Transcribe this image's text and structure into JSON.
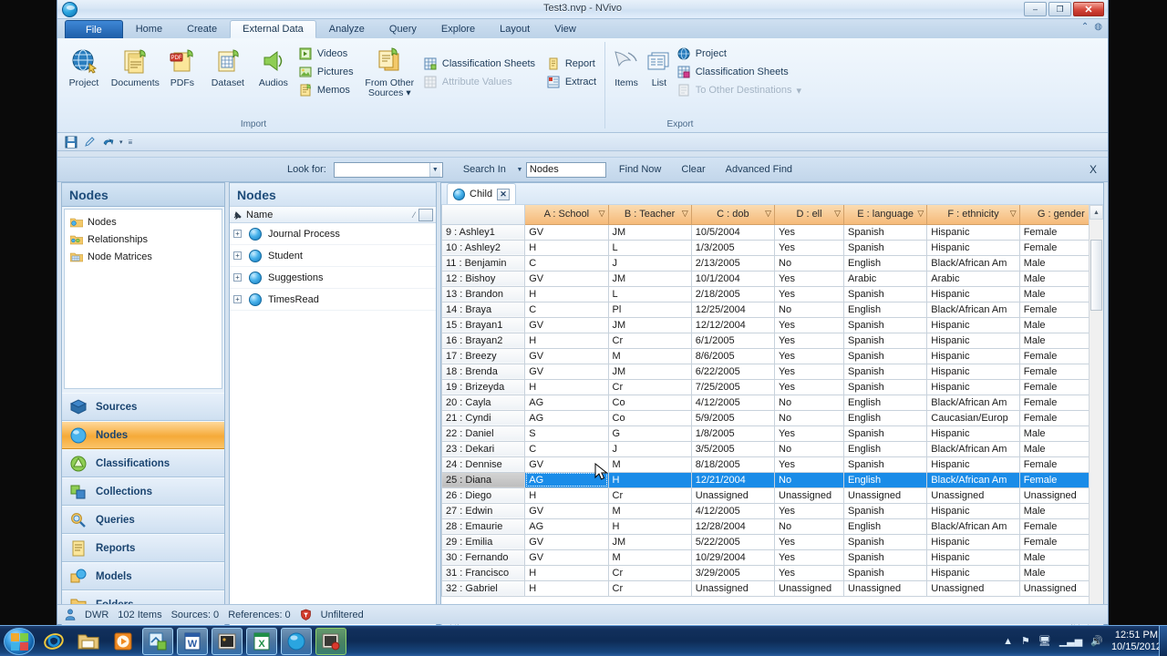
{
  "window": {
    "title": "Test3.nvp - NVivo",
    "minimize": "–",
    "maximize": "❐",
    "close": "✕"
  },
  "ribbon": {
    "tabs": [
      {
        "label": "File",
        "kind": "file"
      },
      {
        "label": "Home",
        "kind": "normal"
      },
      {
        "label": "Create",
        "kind": "normal"
      },
      {
        "label": "External Data",
        "kind": "active"
      },
      {
        "label": "Analyze",
        "kind": "normal"
      },
      {
        "label": "Query",
        "kind": "normal"
      },
      {
        "label": "Explore",
        "kind": "normal"
      },
      {
        "label": "Layout",
        "kind": "normal"
      },
      {
        "label": "View",
        "kind": "normal"
      }
    ],
    "help_icons": [
      "minimize-ribbon-icon",
      "help-icon"
    ],
    "groups": [
      {
        "label": "Import",
        "big_buttons": [
          {
            "label": "Project",
            "icon": "project-globe-icon"
          },
          {
            "label": "Documents",
            "icon": "documents-icon"
          },
          {
            "label": "PDFs",
            "icon": "pdfs-icon"
          },
          {
            "label": "Dataset",
            "icon": "dataset-icon"
          },
          {
            "label": "Audios",
            "icon": "audios-icon"
          }
        ],
        "small_buttons": [
          {
            "label": "Videos",
            "icon": "videos-icon",
            "enabled": true
          },
          {
            "label": "Pictures",
            "icon": "pictures-icon",
            "enabled": true
          },
          {
            "label": "Memos",
            "icon": "memos-icon",
            "enabled": true
          }
        ],
        "from_other": {
          "label_line1": "From Other",
          "label_line2": "Sources",
          "icon": "from-other-sources-icon"
        },
        "classification": [
          {
            "label": "Classification Sheets",
            "icon": "classification-sheets-icon",
            "enabled": true
          },
          {
            "label": "Attribute Values",
            "icon": "attribute-values-icon",
            "enabled": false
          }
        ],
        "report": [
          {
            "label": "Report",
            "icon": "report-icon",
            "enabled": true
          },
          {
            "label": "Extract",
            "icon": "extract-icon",
            "enabled": true
          }
        ]
      },
      {
        "label": "Export",
        "big_buttons": [
          {
            "label": "Items",
            "icon": "items-icon"
          },
          {
            "label": "List",
            "icon": "list-icon"
          }
        ],
        "small_buttons": [
          {
            "label": "Project",
            "icon": "project-globe-icon",
            "enabled": true
          },
          {
            "label": "Classification Sheets",
            "icon": "classification-sheets-icon",
            "enabled": true
          },
          {
            "label": "To Other Destinations",
            "icon": "to-other-destinations-icon",
            "enabled": false
          }
        ]
      }
    ]
  },
  "quick_access": {
    "icons": [
      "save-icon",
      "edit-icon",
      "undo-icon",
      "undo-dropdown-icon",
      "customize-qat-icon"
    ]
  },
  "findbar": {
    "look_for_label": "Look for:",
    "look_for_value": "",
    "search_in_label": "Search In",
    "scope_value": "Nodes",
    "find_now": "Find Now",
    "clear": "Clear",
    "advanced_find": "Advanced Find",
    "close": "X"
  },
  "navpane": {
    "header": "Nodes",
    "tree": [
      {
        "label": "Nodes",
        "icon": "nodes-folder-icon"
      },
      {
        "label": "Relationships",
        "icon": "relationships-folder-icon"
      },
      {
        "label": "Node Matrices",
        "icon": "node-matrices-folder-icon"
      }
    ],
    "buttons": [
      {
        "label": "Sources",
        "icon": "sources-icon",
        "selected": false
      },
      {
        "label": "Nodes",
        "icon": "nodes-icon",
        "selected": true
      },
      {
        "label": "Classifications",
        "icon": "classifications-icon",
        "selected": false
      },
      {
        "label": "Collections",
        "icon": "collections-icon",
        "selected": false
      },
      {
        "label": "Queries",
        "icon": "queries-icon",
        "selected": false
      },
      {
        "label": "Reports",
        "icon": "reports-icon",
        "selected": false
      },
      {
        "label": "Models",
        "icon": "models-icon",
        "selected": false
      },
      {
        "label": "Folders",
        "icon": "folders-icon",
        "selected": false
      }
    ],
    "chevron": "»"
  },
  "listpane": {
    "header": "Nodes",
    "column_header": "Name",
    "items": [
      {
        "label": "Journal Process"
      },
      {
        "label": "Student"
      },
      {
        "label": "Suggestions"
      },
      {
        "label": "TimesRead"
      }
    ]
  },
  "detailpane": {
    "tab": {
      "label": "Child",
      "icon": "node-icon",
      "close": "✕"
    }
  },
  "chart_data": {
    "type": "table",
    "title": "Child",
    "columns": [
      "",
      "A : School",
      "B : Teacher",
      "C : dob",
      "D : ell",
      "E : language",
      "F : ethnicity",
      "G : gender"
    ],
    "rows": [
      [
        "9 : Ashley1",
        "GV",
        "JM",
        "10/5/2004",
        "Yes",
        "Spanish",
        "Hispanic",
        "Female"
      ],
      [
        "10 : Ashley2",
        "H",
        "L",
        "1/3/2005",
        "Yes",
        "Spanish",
        "Hispanic",
        "Female"
      ],
      [
        "11 : Benjamin",
        "C",
        "J",
        "2/13/2005",
        "No",
        "English",
        "Black/African Am",
        "Male"
      ],
      [
        "12 : Bishoy",
        "GV",
        "JM",
        "10/1/2004",
        "Yes",
        "Arabic",
        "Arabic",
        "Male"
      ],
      [
        "13 : Brandon",
        "H",
        "L",
        "2/18/2005",
        "Yes",
        "Spanish",
        "Hispanic",
        "Male"
      ],
      [
        "14 : Braya",
        "C",
        "Pl",
        "12/25/2004",
        "No",
        "English",
        "Black/African Am",
        "Female"
      ],
      [
        "15 : Brayan1",
        "GV",
        "JM",
        "12/12/2004",
        "Yes",
        "Spanish",
        "Hispanic",
        "Male"
      ],
      [
        "16 : Brayan2",
        "H",
        "Cr",
        "6/1/2005",
        "Yes",
        "Spanish",
        "Hispanic",
        "Male"
      ],
      [
        "17 : Breezy",
        "GV",
        "M",
        "8/6/2005",
        "Yes",
        "Spanish",
        "Hispanic",
        "Female"
      ],
      [
        "18 : Brenda",
        "GV",
        "JM",
        "6/22/2005",
        "Yes",
        "Spanish",
        "Hispanic",
        "Female"
      ],
      [
        "19 : Brizeyda",
        "H",
        "Cr",
        "7/25/2005",
        "Yes",
        "Spanish",
        "Hispanic",
        "Female"
      ],
      [
        "20 : Cayla",
        "AG",
        "Co",
        "4/12/2005",
        "No",
        "English",
        "Black/African Am",
        "Female"
      ],
      [
        "21 : Cyndi",
        "AG",
        "Co",
        "5/9/2005",
        "No",
        "English",
        "Caucasian/Europ",
        "Female"
      ],
      [
        "22 : Daniel",
        "S",
        "G",
        "1/8/2005",
        "Yes",
        "Spanish",
        "Hispanic",
        "Male"
      ],
      [
        "23 : Dekari",
        "C",
        "J",
        "3/5/2005",
        "No",
        "English",
        "Black/African Am",
        "Male"
      ],
      [
        "24 : Dennise",
        "GV",
        "M",
        "8/18/2005",
        "Yes",
        "Spanish",
        "Hispanic",
        "Female"
      ],
      [
        "25 : Diana",
        "AG",
        "H",
        "12/21/2004",
        "No",
        "English",
        "Black/African Am",
        "Female"
      ],
      [
        "26 : Diego",
        "H",
        "Cr",
        "Unassigned",
        "Unassigned",
        "Unassigned",
        "Unassigned",
        "Unassigned"
      ],
      [
        "27 : Edwin",
        "GV",
        "M",
        "4/12/2005",
        "Yes",
        "Spanish",
        "Hispanic",
        "Male"
      ],
      [
        "28 : Emaurie",
        "AG",
        "H",
        "12/28/2004",
        "No",
        "English",
        "Black/African Am",
        "Female"
      ],
      [
        "29 : Emilia",
        "GV",
        "JM",
        "5/22/2005",
        "Yes",
        "Spanish",
        "Hispanic",
        "Female"
      ],
      [
        "30 : Fernando",
        "GV",
        "M",
        "10/29/2004",
        "Yes",
        "Spanish",
        "Hispanic",
        "Male"
      ],
      [
        "31 : Francisco",
        "H",
        "Cr",
        "3/29/2005",
        "Yes",
        "Spanish",
        "Hispanic",
        "Male"
      ],
      [
        "32 : Gabriel",
        "H",
        "Cr",
        "Unassigned",
        "Unassigned",
        "Unassigned",
        "Unassigned",
        "Unassigned"
      ]
    ],
    "selected_row_index": 16,
    "selection_color": "#1a8ce8",
    "header_color": "#f5ba79"
  },
  "statusbar": {
    "user": "DWR",
    "items": "102 Items",
    "sources": "Sources: 0",
    "references": "References: 0",
    "filter": "Unfiltered"
  },
  "taskbar": {
    "start": "start-orb-icon",
    "apps": [
      {
        "icon": "internet-explorer-icon",
        "pinned": true,
        "active": false
      },
      {
        "icon": "windows-explorer-icon",
        "pinned": true,
        "active": false
      },
      {
        "icon": "media-player-icon",
        "pinned": true,
        "active": false
      },
      {
        "icon": "snagit-icon",
        "pinned": true,
        "active": true
      },
      {
        "icon": "word-icon",
        "pinned": true,
        "active": true
      },
      {
        "icon": "photo-app-icon",
        "pinned": true,
        "active": true
      },
      {
        "icon": "excel-icon",
        "pinned": true,
        "active": true
      },
      {
        "icon": "nvivo-icon",
        "pinned": true,
        "active": true
      },
      {
        "icon": "camtasia-icon",
        "pinned": true,
        "active": true
      }
    ],
    "tray": [
      "show-hidden-icons",
      "action-center-flag-icon",
      "network-tasks-icon",
      "network-signal-icon",
      "volume-icon"
    ],
    "clock_time": "12:51 PM",
    "clock_date": "10/15/2012"
  }
}
